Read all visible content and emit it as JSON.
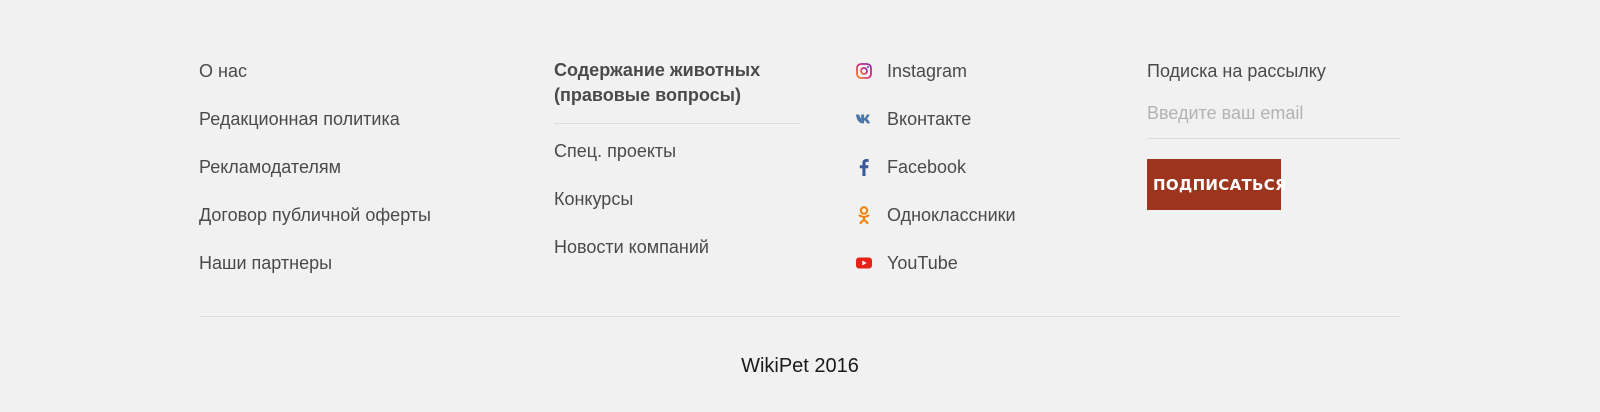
{
  "col_about": {
    "links": [
      "О нас",
      "Редакционная политика",
      "Рекламодателям",
      "Договор публичной оферты",
      "Наши партнеры"
    ]
  },
  "col_content": {
    "heading": "Содержание животных (правовые вопросы)",
    "links": [
      "Спец. проекты",
      "Конкурсы",
      "Новости компаний"
    ]
  },
  "col_social": {
    "items": [
      {
        "label": "Instagram",
        "icon": "instagram-icon",
        "color": "#c13584"
      },
      {
        "label": "Вконтакте",
        "icon": "vk-icon",
        "color": "#4a76a8"
      },
      {
        "label": "Facebook",
        "icon": "facebook-icon",
        "color": "#3b5998"
      },
      {
        "label": "Одноклассники",
        "icon": "odnoklassniki-icon",
        "color": "#ee8208"
      },
      {
        "label": "YouTube",
        "icon": "youtube-icon",
        "color": "#e62117"
      }
    ]
  },
  "subscribe": {
    "title": "Подиска на рассылку",
    "placeholder": "Введите ваш email",
    "value": "",
    "button_label": "ПОДПИСАТЬСЯ",
    "button_color": "#9c341e"
  },
  "copyright": "WikiPet 2016"
}
